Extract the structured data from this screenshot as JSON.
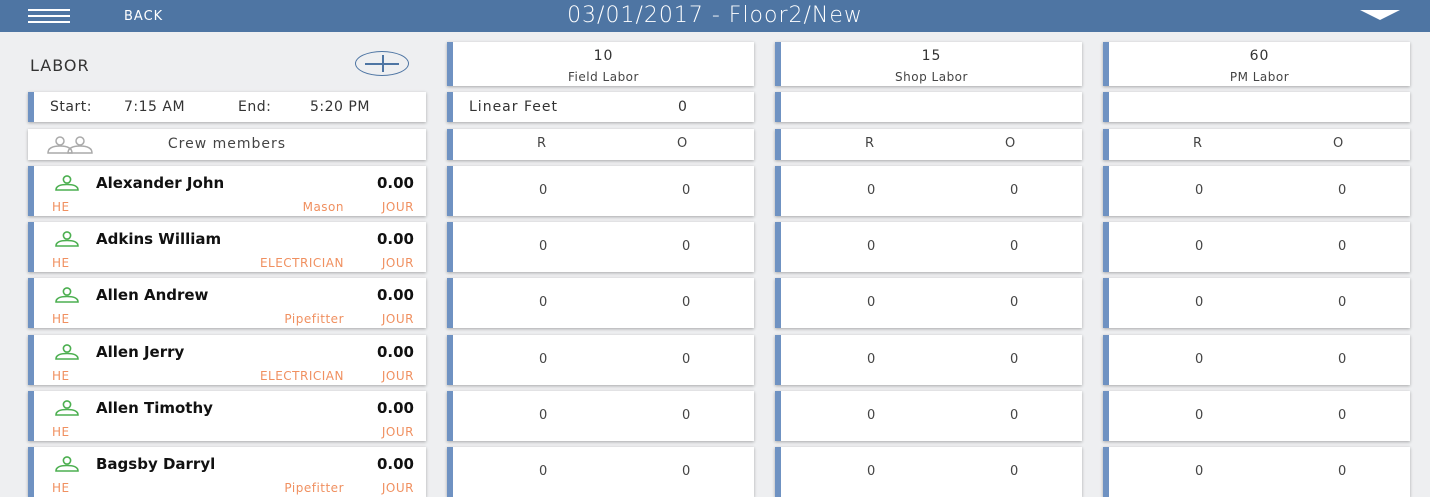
{
  "header": {
    "back_label": "BACK",
    "title": "03/01/2017 - Floor2/New"
  },
  "labor": {
    "title": "LABOR",
    "start_label": "Start:",
    "start_time": "7:15 AM",
    "end_label": "End:",
    "end_time": "5:20 PM",
    "crew_label": "Crew members"
  },
  "columns": [
    {
      "value": "10",
      "name": "Field Labor",
      "extra_label": "Linear Feet",
      "extra_value": "0",
      "r": "R",
      "o": "O"
    },
    {
      "value": "15",
      "name": "Shop Labor",
      "extra_label": "",
      "extra_value": "",
      "r": "R",
      "o": "O"
    },
    {
      "value": "60",
      "name": "PM Labor",
      "extra_label": "",
      "extra_value": "",
      "r": "R",
      "o": "O"
    }
  ],
  "employees": [
    {
      "name": "Alexander John",
      "hours": "0.00",
      "code": "HE",
      "trade": "Mason",
      "level": "JOUR",
      "cells": [
        [
          "0",
          "0"
        ],
        [
          "0",
          "0"
        ],
        [
          "0",
          "0"
        ]
      ]
    },
    {
      "name": "Adkins William",
      "hours": "0.00",
      "code": "HE",
      "trade": "ELECTRICIAN",
      "level": "JOUR",
      "cells": [
        [
          "0",
          "0"
        ],
        [
          "0",
          "0"
        ],
        [
          "0",
          "0"
        ]
      ]
    },
    {
      "name": "Allen Andrew",
      "hours": "0.00",
      "code": "HE",
      "trade": "Pipefitter",
      "level": "JOUR",
      "cells": [
        [
          "0",
          "0"
        ],
        [
          "0",
          "0"
        ],
        [
          "0",
          "0"
        ]
      ]
    },
    {
      "name": "Allen Jerry",
      "hours": "0.00",
      "code": "HE",
      "trade": "ELECTRICIAN",
      "level": "JOUR",
      "cells": [
        [
          "0",
          "0"
        ],
        [
          "0",
          "0"
        ],
        [
          "0",
          "0"
        ]
      ]
    },
    {
      "name": "Allen Timothy",
      "hours": "0.00",
      "code": "HE",
      "trade": "",
      "level": "JOUR",
      "cells": [
        [
          "0",
          "0"
        ],
        [
          "0",
          "0"
        ],
        [
          "0",
          "0"
        ]
      ]
    },
    {
      "name": "Bagsby Darryl",
      "hours": "0.00",
      "code": "HE",
      "trade": "Pipefitter",
      "level": "JOUR",
      "cells": [
        [
          "0",
          "0"
        ],
        [
          "0",
          "0"
        ],
        [
          "0",
          "0"
        ]
      ]
    }
  ],
  "colors": {
    "header_bg": "#4e75a3",
    "accent_bar": "#6f92c2",
    "person_icon": "#4caf50",
    "sub_text": "#f09060"
  },
  "icons": {
    "menu": "hamburger-icon",
    "dropdown": "caret-down-icon",
    "add": "plus-circle-icon",
    "crew": "people-icon",
    "person": "person-icon"
  }
}
